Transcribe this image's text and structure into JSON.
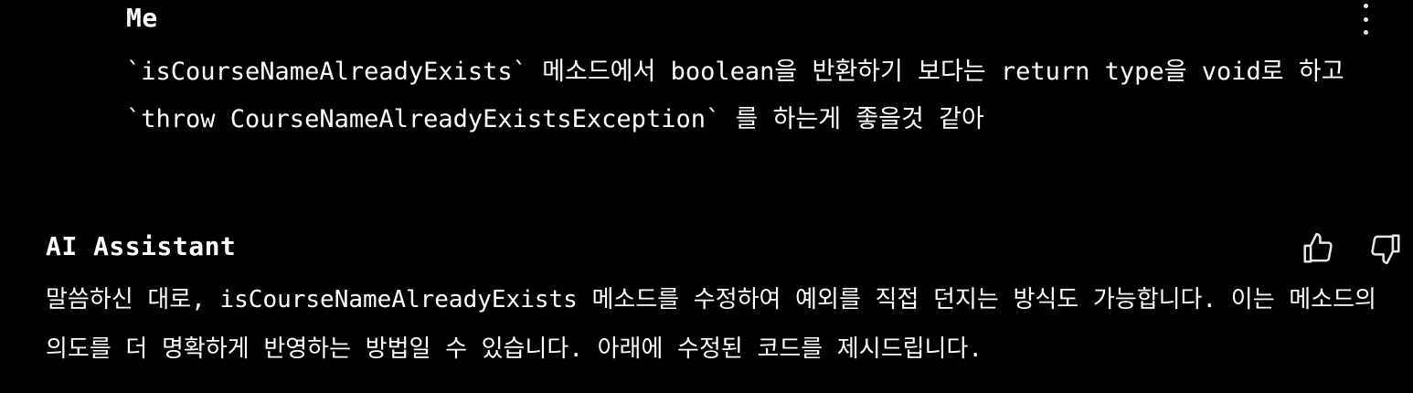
{
  "user_message": {
    "author": "Me",
    "text": "`isCourseNameAlreadyExists` 메소드에서 boolean을 반환하기 보다는 return type을 void로 하고 `throw CourseNameAlreadyExistsException` 를 하는게 좋을것 같아"
  },
  "assistant_message": {
    "author": "AI Assistant",
    "text": "말씀하신 대로, isCourseNameAlreadyExists 메소드를 수정하여 예외를 직접 던지는 방식도 가능합니다. 이는 메소드의 의도를 더 명확하게 반영하는 방법일 수 있습니다. 아래에 수정된 코드를 제시드립니다."
  },
  "icons": {
    "more": "more-vertical-icon",
    "like": "thumbs-up-icon",
    "dislike": "thumbs-down-icon"
  },
  "colors": {
    "background": "#000000",
    "text": "#ffffff",
    "icon": "#e6e6e6"
  }
}
